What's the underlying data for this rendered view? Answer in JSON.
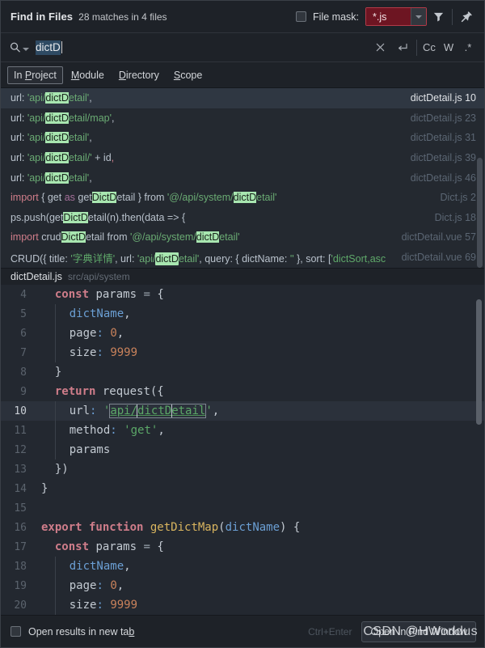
{
  "header": {
    "title": "Find in Files",
    "summary": "28 matches in 4 files",
    "file_mask_label": "File mask:",
    "file_mask_value": "*.js",
    "file_mask_checked": false,
    "filter_icon": "filter-icon",
    "pin_icon": "pin-icon"
  },
  "search": {
    "value": "dictD",
    "placeholder": "",
    "search_icon": "search-icon",
    "clear_icon": "close-icon",
    "newline_icon": "new-line-icon",
    "toggles": [
      {
        "name": "match-case",
        "label": "Cc"
      },
      {
        "name": "words",
        "label": "W"
      },
      {
        "name": "regex",
        "label": ".*"
      }
    ]
  },
  "scope": {
    "tabs": [
      {
        "label": "In Project",
        "active": true
      },
      {
        "label": "Module",
        "active": false
      },
      {
        "label": "Directory",
        "active": false
      },
      {
        "label": "Scope",
        "active": false
      }
    ]
  },
  "results": {
    "rows": [
      {
        "selected": true,
        "text": "url: 'api/dictDetail',",
        "file": "dictDetail.js",
        "line": "10"
      },
      {
        "selected": false,
        "text": "url: 'api/dictDetail/map',",
        "file": "dictDetail.js",
        "line": "23"
      },
      {
        "selected": false,
        "text": "url: 'api/dictDetail',",
        "file": "dictDetail.js",
        "line": "31"
      },
      {
        "selected": false,
        "text": "url: 'api/dictDetail/' + id,",
        "file": "dictDetail.js",
        "line": "39"
      },
      {
        "selected": false,
        "text": "url: 'api/dictDetail',",
        "file": "dictDetail.js",
        "line": "46"
      },
      {
        "selected": false,
        "text": "import { get as getDictDetail } from '@/api/system/dictDetail'",
        "file": "Dict.js",
        "line": "2"
      },
      {
        "selected": false,
        "text": "ps.push(getDictDetail(n).then(data => {",
        "file": "Dict.js",
        "line": "18"
      },
      {
        "selected": false,
        "text": "import crudDictDetail from '@/api/system/dictDetail'",
        "file": "dictDetail.vue",
        "line": "57"
      },
      {
        "selected": false,
        "text": "CRUD({ title: '字典详情', url: 'api/dictDetail', query: { dictName: '' }, sort: ['dictSort,asc",
        "file": "dictDetail.vue",
        "line": "69"
      }
    ]
  },
  "file_header": {
    "name": "dictDetail.js",
    "path": "src/api/system"
  },
  "code": {
    "lines": [
      {
        "num": "4",
        "highlight": false
      },
      {
        "num": "5",
        "highlight": false
      },
      {
        "num": "6",
        "highlight": false
      },
      {
        "num": "7",
        "highlight": false
      },
      {
        "num": "8",
        "highlight": false
      },
      {
        "num": "9",
        "highlight": false
      },
      {
        "num": "10",
        "highlight": true
      },
      {
        "num": "11",
        "highlight": false
      },
      {
        "num": "12",
        "highlight": false
      },
      {
        "num": "13",
        "highlight": false
      },
      {
        "num": "14",
        "highlight": false
      },
      {
        "num": "15",
        "highlight": false
      },
      {
        "num": "16",
        "highlight": false
      },
      {
        "num": "17",
        "highlight": false
      },
      {
        "num": "18",
        "highlight": false
      },
      {
        "num": "19",
        "highlight": false
      },
      {
        "num": "20",
        "highlight": false
      }
    ],
    "text": {
      "l4": "const params = {",
      "l5": "dictName,",
      "l6": "page: 0,",
      "l7": "size: 9999",
      "l8": "}",
      "l9": "return request({",
      "l10": "url: 'api/dictDetail',",
      "l11": "method: 'get',",
      "l12": "params",
      "l13": "})",
      "l14": "}",
      "l15": "",
      "l16": "export function getDictMap(dictName) {",
      "l17": "const params = {",
      "l18": "dictName,",
      "l19": "page: 0,",
      "l20": "size: 9999"
    }
  },
  "footer": {
    "checkbox_label": "Open results in new tab",
    "checkbox_checked": false,
    "shortcut": "Ctrl+Enter",
    "button_label": "Open in Find Window",
    "watermark": "CSDN @HWorldus"
  },
  "colors": {
    "accent_highlight": "#a8e6b0",
    "mask_bg": "#6d1522",
    "selection_bg": "#2f3742",
    "panel_bg": "#1e2228",
    "code_bg": "#232830"
  }
}
